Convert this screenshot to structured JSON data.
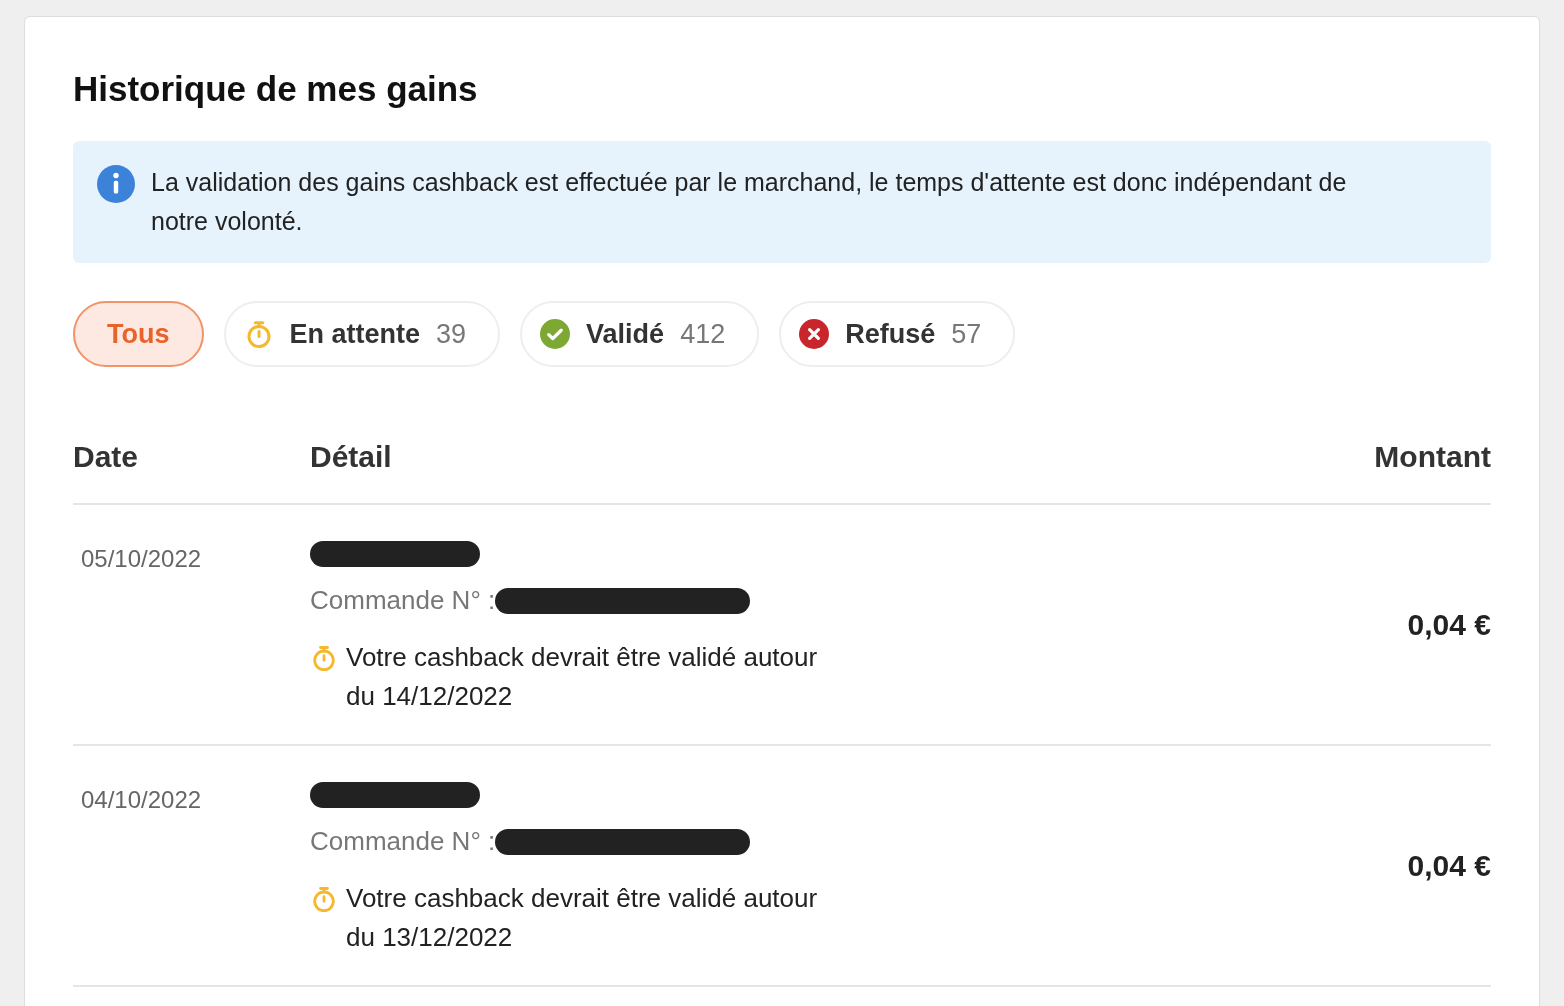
{
  "title": "Historique de mes gains",
  "info": {
    "text": "La validation des gains cashback est effectuée par le marchand, le temps d'attente est donc indépendant de notre volonté."
  },
  "filters": [
    {
      "kind": "all",
      "label": "Tous",
      "selected": true
    },
    {
      "kind": "pending",
      "label": "En attente",
      "count": "39",
      "selected": false
    },
    {
      "kind": "valid",
      "label": "Validé",
      "count": "412",
      "selected": false
    },
    {
      "kind": "refused",
      "label": "Refusé",
      "count": "57",
      "selected": false
    }
  ],
  "table": {
    "columns": [
      "Date",
      "Détail",
      "Montant"
    ],
    "rows": [
      {
        "date": "05/10/2022",
        "merchant_redacted": true,
        "order_label": "Commande N° :",
        "order_redacted": true,
        "kind": "pending",
        "note": "Votre cashback devrait être validé autour du 14/12/2022",
        "amount": "0,04 €"
      },
      {
        "date": "04/10/2022",
        "merchant_redacted": true,
        "order_label": "Commande N° :",
        "order_redacted": true,
        "kind": "pending",
        "note": "Votre cashback devrait être validé autour du 13/12/2022",
        "amount": "0,04 €"
      }
    ]
  }
}
